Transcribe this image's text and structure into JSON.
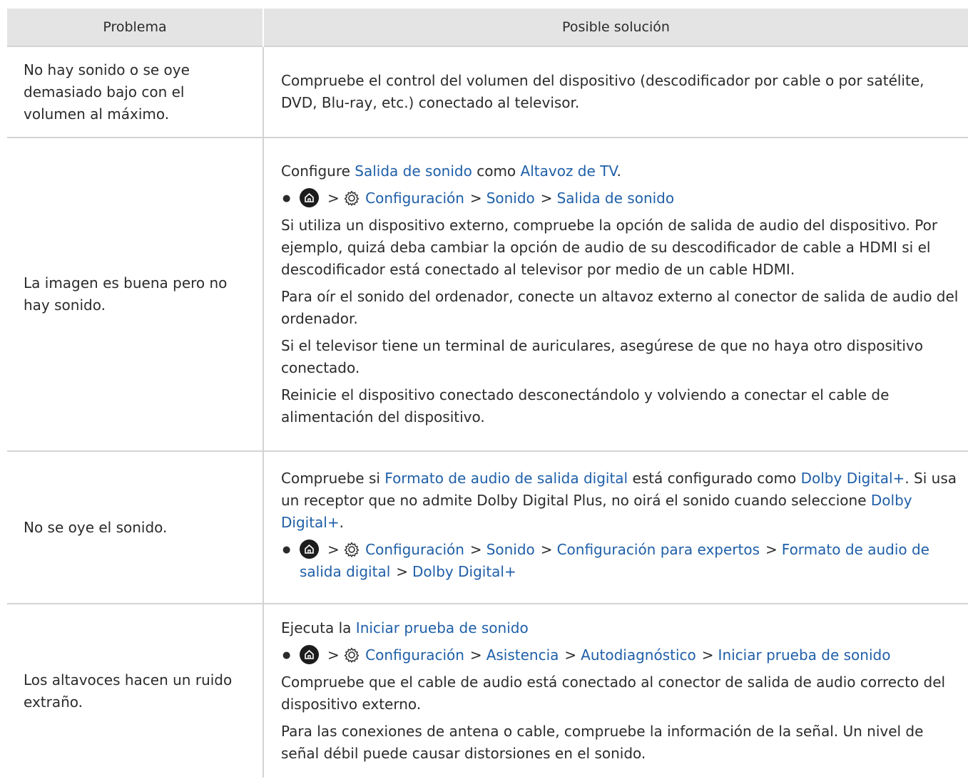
{
  "headers": {
    "problem": "Problema",
    "solution": "Posible solución"
  },
  "rows": [
    {
      "problem": "No hay sonido o se oye demasiado bajo con el volumen al máximo.",
      "p1": "Compruebe el control del volumen del dispositivo (descodificador por cable o por satélite, DVD, Blu-ray, etc.) conectado al televisor."
    },
    {
      "problem": "La imagen es buena pero no hay sonido.",
      "intro_a": "Configure ",
      "intro_link1": "Salida de sonido",
      "intro_b": " como ",
      "intro_link2": "Altavoz de TV",
      "intro_c": ".",
      "path": [
        "Configuración",
        "Sonido",
        "Salida de sonido"
      ],
      "p2": "Si utiliza un dispositivo externo, compruebe la opción de salida de audio del dispositivo. Por ejemplo, quizá deba cambiar la opción de audio de su descodificador de cable a HDMI si el descodificador está conectado al televisor por medio de un cable HDMI.",
      "p3": "Para oír el sonido del ordenador, conecte un altavoz externo al conector de salida de audio del ordenador.",
      "p4": "Si el televisor tiene un terminal de auriculares, asegúrese de que no haya otro dispositivo conectado.",
      "p5": "Reinicie el dispositivo conectado desconectándolo y volviendo a conectar el cable de alimentación del dispositivo."
    },
    {
      "problem": "No se oye el sonido.",
      "a": "Compruebe si ",
      "link1": "Formato de audio de salida digital",
      "b": " está configurado como ",
      "link2": "Dolby Digital+",
      "c": ". Si usa un receptor que no admite Dolby Digital Plus, no oirá el sonido cuando seleccione ",
      "link3": "Dolby Digital+",
      "d": ".",
      "path": [
        "Configuración",
        "Sonido",
        "Configuración para expertos",
        "Formato de audio de salida digital",
        "Dolby Digital+"
      ]
    },
    {
      "problem": "Los altavoces hacen un ruido extraño.",
      "intro_a": "Ejecuta la ",
      "intro_link": "Iniciar prueba de sonido",
      "path": [
        "Configuración",
        "Asistencia",
        "Autodiagnóstico",
        "Iniciar prueba de sonido"
      ],
      "p2": "Compruebe que el cable de audio está conectado al conector de salida de audio correcto del dispositivo externo.",
      "p3": "Para las conexiones de antena o cable, compruebe la información de la señal. Un nivel de señal débil puede causar distorsiones en el sonido."
    }
  ],
  "icons": {
    "home": "home-icon",
    "settings": "gear-icon",
    "separator": "chevron-right-icon"
  },
  "colors": {
    "link": "#1f5fa8",
    "header_bg": "#e4e4e4",
    "border": "#d3d3d3"
  }
}
